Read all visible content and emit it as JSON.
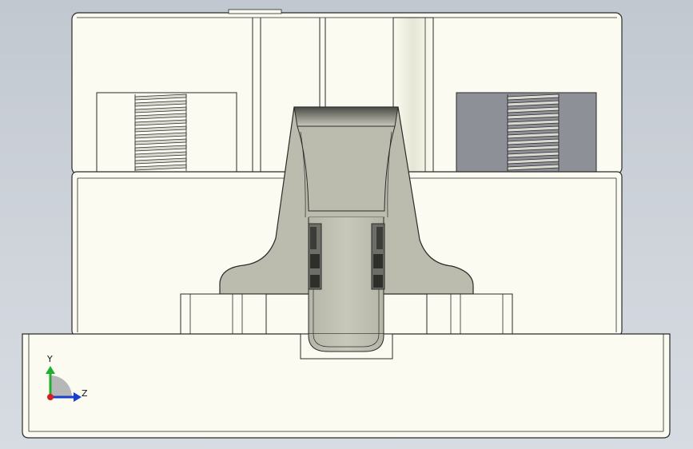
{
  "view": {
    "background_top": "#c2c8d0",
    "background_bottom": "#d7dbe2",
    "part_fill": "#fbfbf2",
    "edge_color": "#2a2a2a",
    "spring_clip_fill": "#bcbcae",
    "spring_clip_dark": "#5a5a55",
    "pocket_fill": "#8e9098"
  },
  "triad": {
    "y_label": "Y",
    "z_label": "Z",
    "y_color": "#1fae2e",
    "z_color": "#1a3fd0",
    "x_color": "#d81e1e"
  }
}
